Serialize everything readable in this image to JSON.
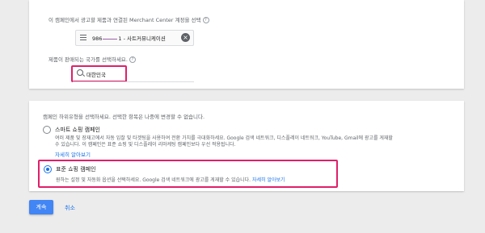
{
  "merchant_section": {
    "label": "이 캠페인에서 광고할 제품과 연결된 Merchant Center 계정을 선택",
    "account_value_prefix": "986",
    "account_value_suffix": "1 - 사트커뮤니케이션"
  },
  "country_section": {
    "label": "제품이 판매되는 국가를 선택하세요.",
    "selected_country": "대한민국"
  },
  "subtype_section": {
    "label": "캠페인 하위유형을 선택하세요. 선택한 항목은 나중에 변경할 수 없습니다.",
    "options": [
      {
        "title": "스마트 쇼핑 캠페인",
        "description": "여러 제품 및 장재고에서 자동 입찰 및 타겟팅을 사용하여 전환 가치를 극대화하세요. Google 검색 네트워크, 디스플레이 네트워크, YouTube, Gmail에 광고를 게재할 수 있습니다. 이 캠페인은 표준 쇼핑 및 디스플레이 리마케팅 캠페인보다 우선 적용됩니다.",
        "link": "자세히 알아보기",
        "selected": false
      },
      {
        "title": "표준 쇼핑 캠페인",
        "description": "원하는 설정 및 자동화 옵션을 선택하세요. Google 검색 네트워크에 광고를 게재할 수 있습니다.",
        "link": "자세히 알아보기",
        "selected": true
      }
    ]
  },
  "actions": {
    "continue_label": "계속",
    "cancel_label": "취소"
  },
  "colors": {
    "accent": "#1a73e8",
    "highlight": "#e01f6a",
    "primary_button": "#4285f4"
  }
}
